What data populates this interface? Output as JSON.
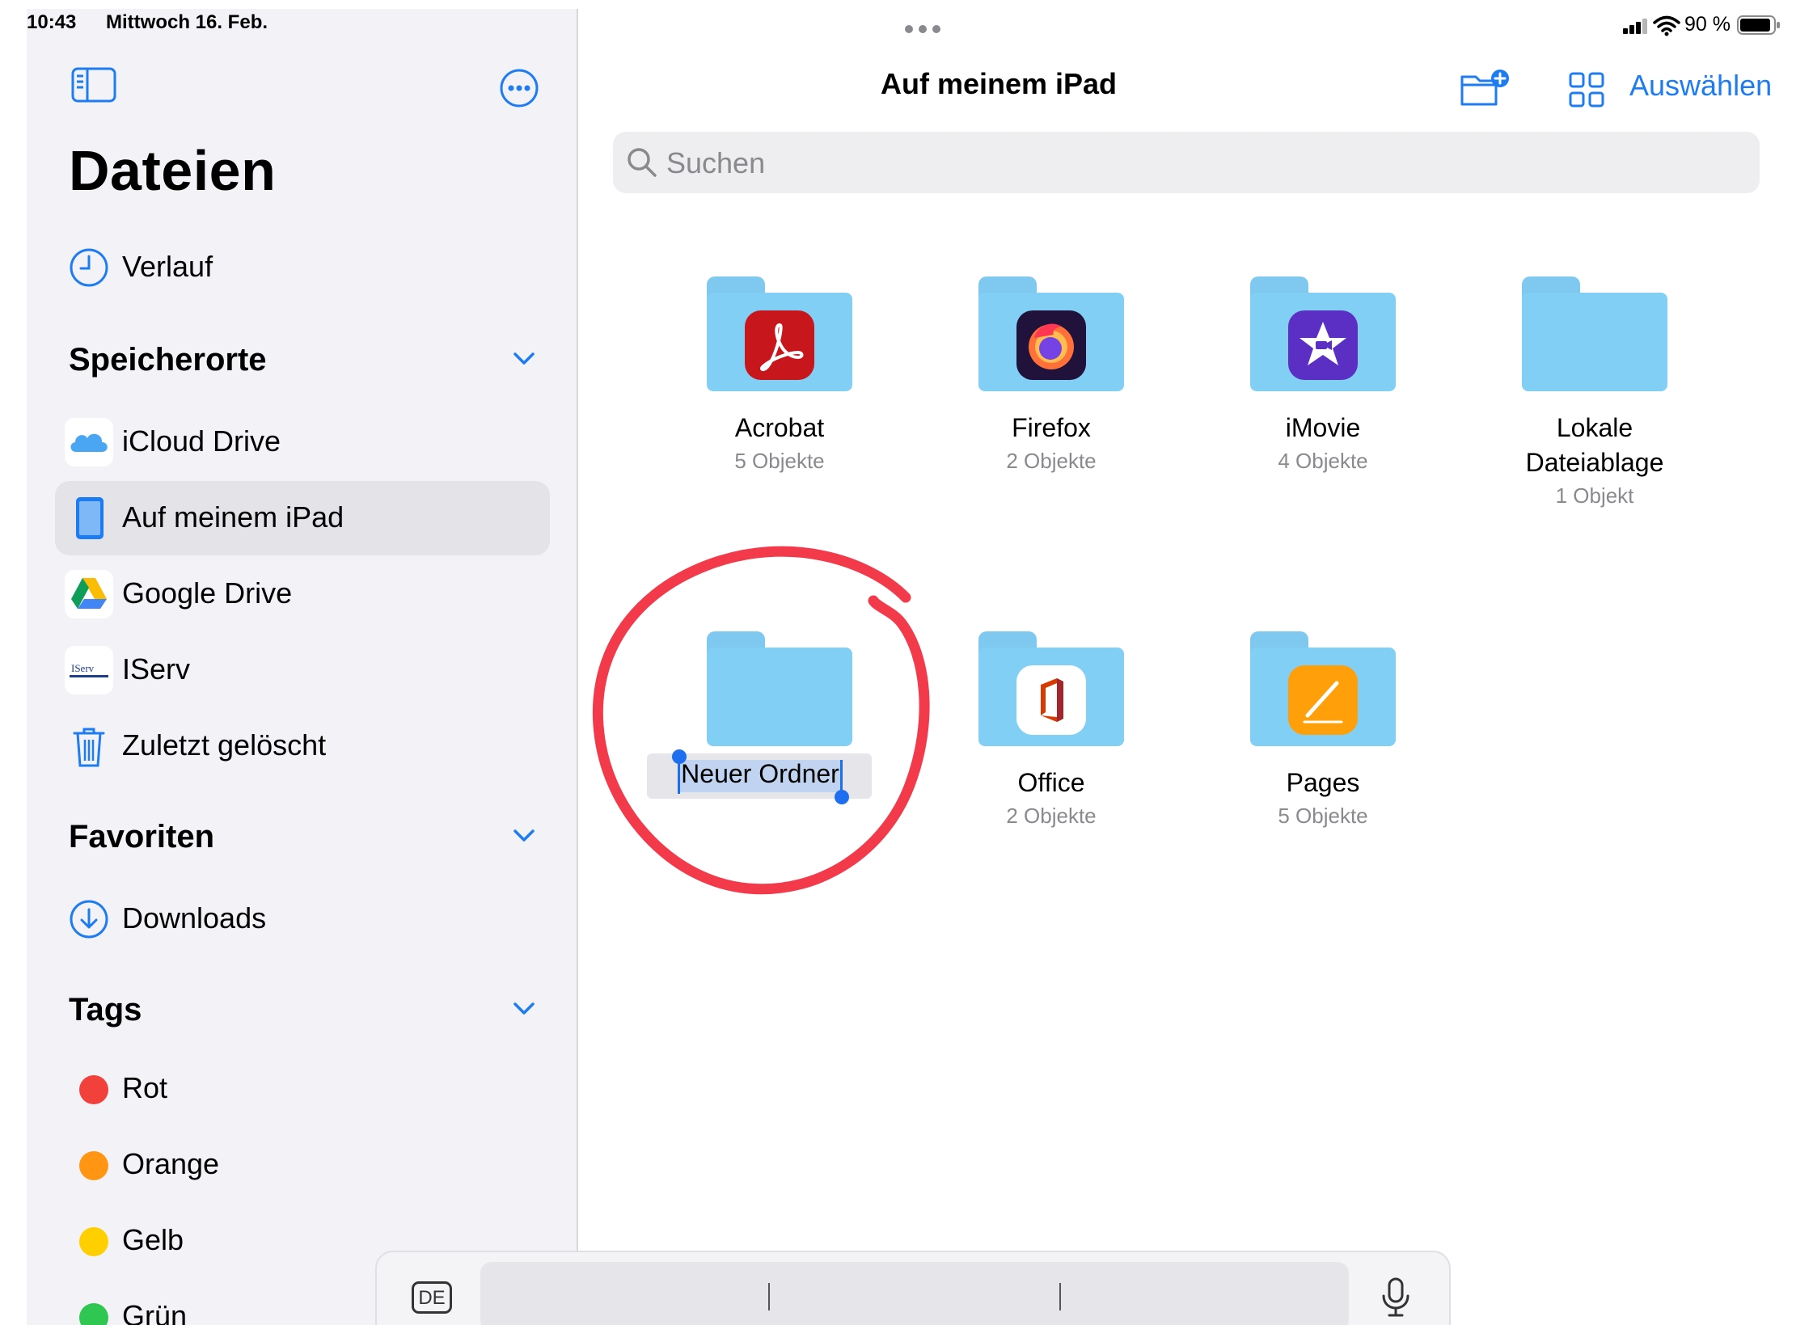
{
  "status": {
    "time": "10:43",
    "date": "Mittwoch 16. Feb.",
    "battery": "90 %"
  },
  "sidebar": {
    "title": "Dateien",
    "recents": "Verlauf",
    "sections": {
      "locations": "Speicherorte",
      "favorites": "Favoriten",
      "tags": "Tags"
    },
    "locations": [
      {
        "label": "iCloud Drive",
        "icon": "icloud-icon"
      },
      {
        "label": "Auf meinem iPad",
        "icon": "ipad-icon",
        "selected": true
      },
      {
        "label": "Google Drive",
        "icon": "google-drive-icon"
      },
      {
        "label": "IServ",
        "icon": "iserv-icon",
        "icon_text": "IServ"
      },
      {
        "label": "Zuletzt gelöscht",
        "icon": "trash-icon"
      }
    ],
    "favorites": [
      {
        "label": "Downloads",
        "icon": "download-icon"
      }
    ],
    "tags": [
      {
        "label": "Rot",
        "color": "#f2413a"
      },
      {
        "label": "Orange",
        "color": "#ff9513"
      },
      {
        "label": "Gelb",
        "color": "#ffcf00"
      },
      {
        "label": "Grün",
        "color": "#2fc752"
      }
    ]
  },
  "main": {
    "title": "Auf meinem iPad",
    "select": "Auswählen",
    "search_placeholder": "Suchen",
    "folders": [
      {
        "name": "Acrobat",
        "count": "5 Objekte",
        "app": "acrobat"
      },
      {
        "name": "Firefox",
        "count": "2 Objekte",
        "app": "firefox"
      },
      {
        "name": "iMovie",
        "count": "4 Objekte",
        "app": "imovie"
      },
      {
        "name_line1": "Lokale",
        "name_line2": "Dateiablage",
        "count": "1 Objekt",
        "app": "none"
      },
      {
        "name": "Neuer Ordner",
        "count": "",
        "app": "none",
        "editing": true
      },
      {
        "name": "Office",
        "count": "2 Objekte",
        "app": "office"
      },
      {
        "name": "Pages",
        "count": "5 Objekte",
        "app": "pages"
      }
    ]
  },
  "keyboard_bar": {
    "language": "DE"
  },
  "colors": {
    "accent": "#1e7cf3",
    "annotation": "#f23a4a",
    "folder": "#82cff5"
  }
}
